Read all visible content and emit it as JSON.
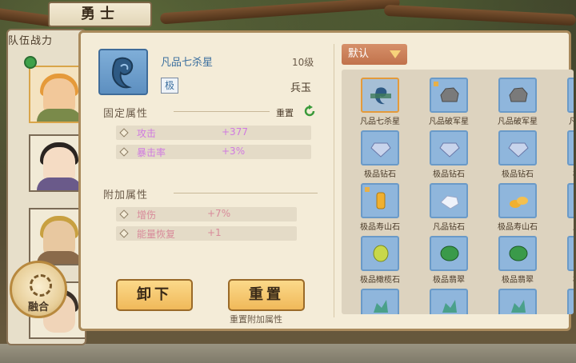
{
  "title_tab": "勇士",
  "roster": {
    "title": "队伍战力",
    "merge_label": "融合"
  },
  "item": {
    "name": "凡品七杀星",
    "level": "10级",
    "tier": "极",
    "category": "兵玉"
  },
  "fixed_attrs": {
    "title": "固定属性",
    "reset_label": "重置",
    "rows": [
      {
        "name": "攻击",
        "value": "+377"
      },
      {
        "name": "暴击率",
        "value": "+3%"
      }
    ]
  },
  "extra_attrs": {
    "title": "附加属性",
    "rows": [
      {
        "name": "增伤",
        "value": "+7%"
      },
      {
        "name": "能量恢复",
        "value": "+1"
      }
    ]
  },
  "buttons": {
    "unequip": "卸下",
    "reset": "重置",
    "reset_caption": "重置附加属性"
  },
  "inventory": {
    "sort": "默认",
    "items": [
      {
        "label": "凡品七杀星"
      },
      {
        "label": "凡品破军星"
      },
      {
        "label": "凡品破军星"
      },
      {
        "label": "凡品"
      },
      {
        "label": "极品钻石"
      },
      {
        "label": "极品钻石"
      },
      {
        "label": "极品钻石"
      },
      {
        "label": "极"
      },
      {
        "label": "极品寿山石"
      },
      {
        "label": "凡品钻石"
      },
      {
        "label": "极品寿山石"
      },
      {
        "label": "凡"
      },
      {
        "label": "极品橄榄石"
      },
      {
        "label": "极品翡翠"
      },
      {
        "label": "极品翡翠"
      },
      {
        "label": "极"
      }
    ]
  },
  "colors": {
    "attr_fixed": "#d07ae0",
    "attr_extra": "#d88a9a",
    "accent_orange": "#f0b95a",
    "slot_blue": "#8fb6dc"
  }
}
